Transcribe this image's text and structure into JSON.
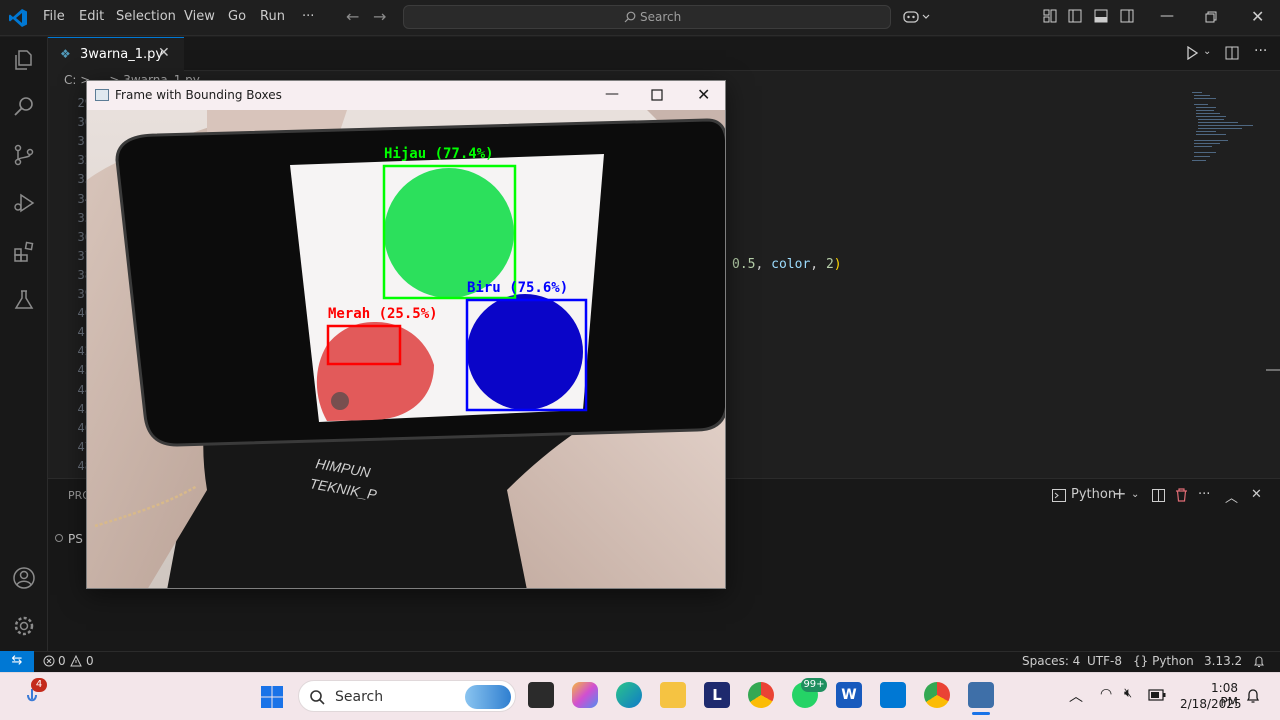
{
  "menu": {
    "file": "File",
    "edit": "Edit",
    "selection": "Selection",
    "view": "View",
    "go": "Go",
    "run": "Run",
    "more": "···"
  },
  "search": {
    "placeholder": "Search"
  },
  "editor": {
    "tab_name": "3warna_1.py",
    "breadcrumb": "C: > ... > 3warna_1.py",
    "line_numbers": [
      "29",
      "30",
      "31",
      "32",
      "33",
      "34",
      "35",
      "36",
      "37",
      "38",
      "39",
      "40",
      "41",
      "42",
      "43",
      "44",
      "45",
      "46",
      "47",
      "48"
    ],
    "code_fragment": {
      "part1": "0.5",
      "sep1": ", ",
      "part2": "color",
      "sep2": ", ",
      "part3": "2",
      "close": ")"
    }
  },
  "panel": {
    "tab": "PROBLEMS",
    "prompt": "PS",
    "shell": "Python"
  },
  "statusbar": {
    "errors": "0",
    "warnings": "0",
    "spaces": "Spaces: 4",
    "encoding": "UTF-8",
    "language": "{} Python",
    "version": "3.13.2"
  },
  "cv_window": {
    "title": "Frame with Bounding Boxes",
    "detections": [
      {
        "label": "Hijau (77.4%)",
        "color": "#00ff00"
      },
      {
        "label": "Biru (75.6%)",
        "color": "#0000ff"
      },
      {
        "label": "Merah (25.5%)",
        "color": "#ff0000"
      }
    ],
    "shirt_text_1": "HIMPUN",
    "shirt_text_2": "TEKNIK_P"
  },
  "taskbar": {
    "search_label": "Search",
    "notification_badge": "4",
    "whatsapp_badge": "99+",
    "time": "1:08 PM",
    "date": "2/18/2025"
  },
  "colors": {
    "accent": "#0078d4",
    "editor_bg": "#1f1f1f",
    "taskbar_bg": "#f3e6ea"
  }
}
